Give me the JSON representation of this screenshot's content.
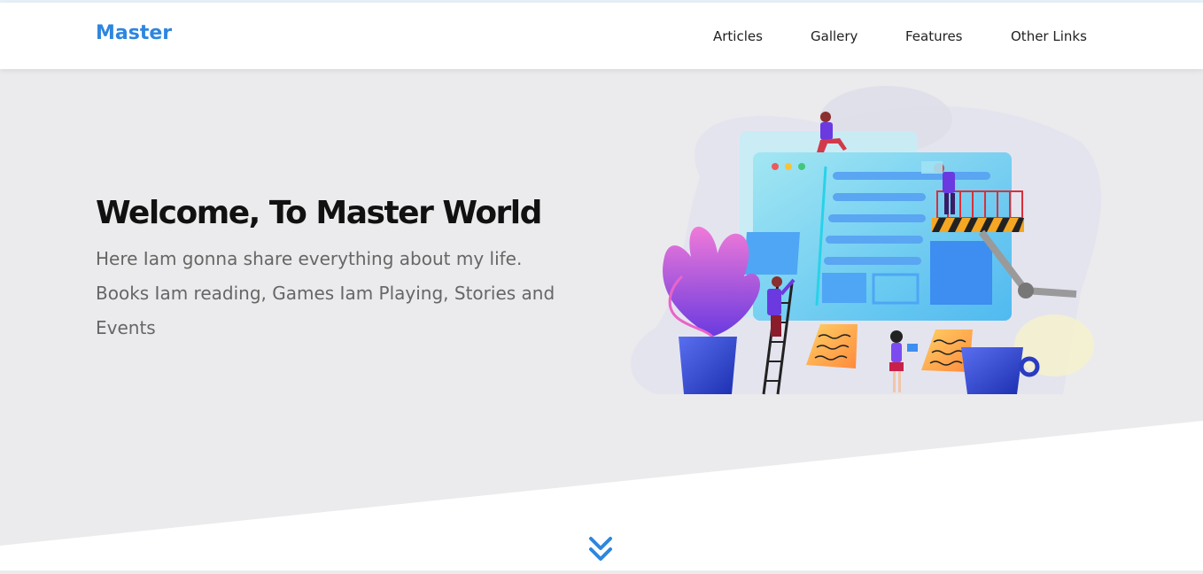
{
  "header": {
    "logo": "Master",
    "nav": [
      {
        "label": "Articles"
      },
      {
        "label": "Gallery"
      },
      {
        "label": "Features"
      },
      {
        "label": "Other Links"
      }
    ]
  },
  "hero": {
    "title": "Welcome, To Master World",
    "subtitle": "Here Iam gonna share everything about my life. Books Iam reading, Games Iam Playing, Stories and Events"
  },
  "icons": {
    "scroll_down": "double-chevron-down-icon"
  },
  "colors": {
    "brand": "#2e86de",
    "hero_bg": "#ebebed",
    "title": "#111111",
    "subtitle": "#666666"
  }
}
